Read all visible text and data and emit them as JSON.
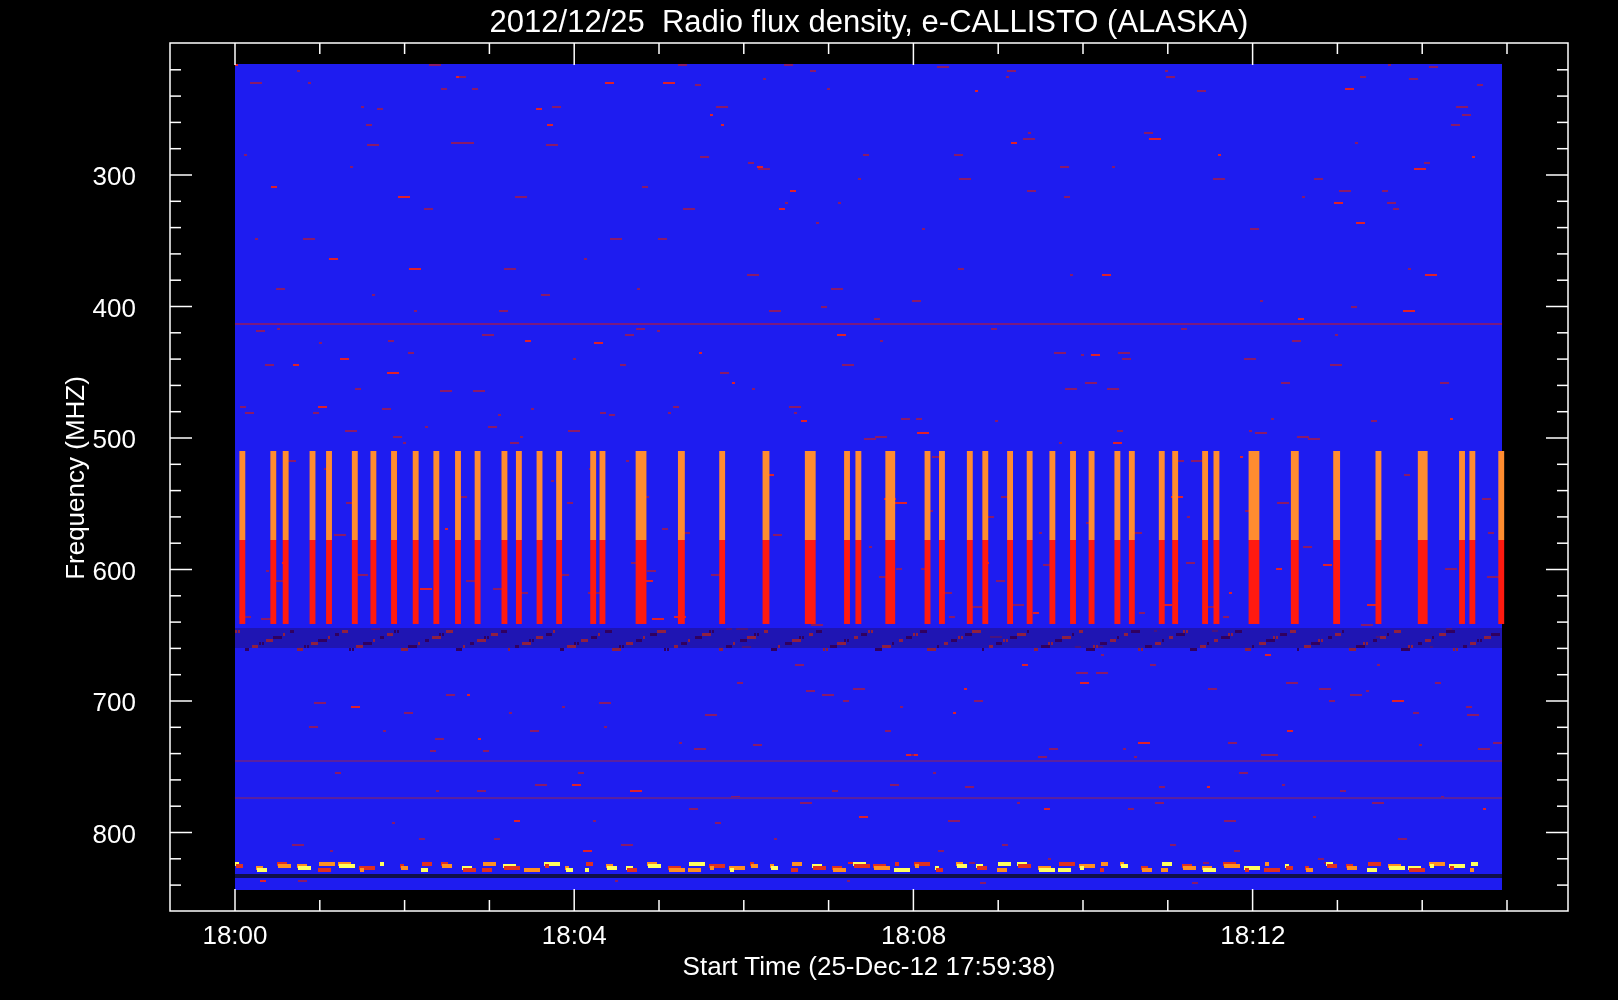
{
  "title": "2012/12/25  Radio flux density, e-CALLISTO (ALASKA)",
  "y_axis": {
    "label": "Frequency (MHZ)",
    "ticks": [
      "300",
      "400",
      "500",
      "600",
      "700",
      "800"
    ]
  },
  "x_axis": {
    "label": "Start Time (25-Dec-12 17:59:38)",
    "ticks": [
      "18:00",
      "18:04",
      "18:08",
      "18:12"
    ]
  }
}
